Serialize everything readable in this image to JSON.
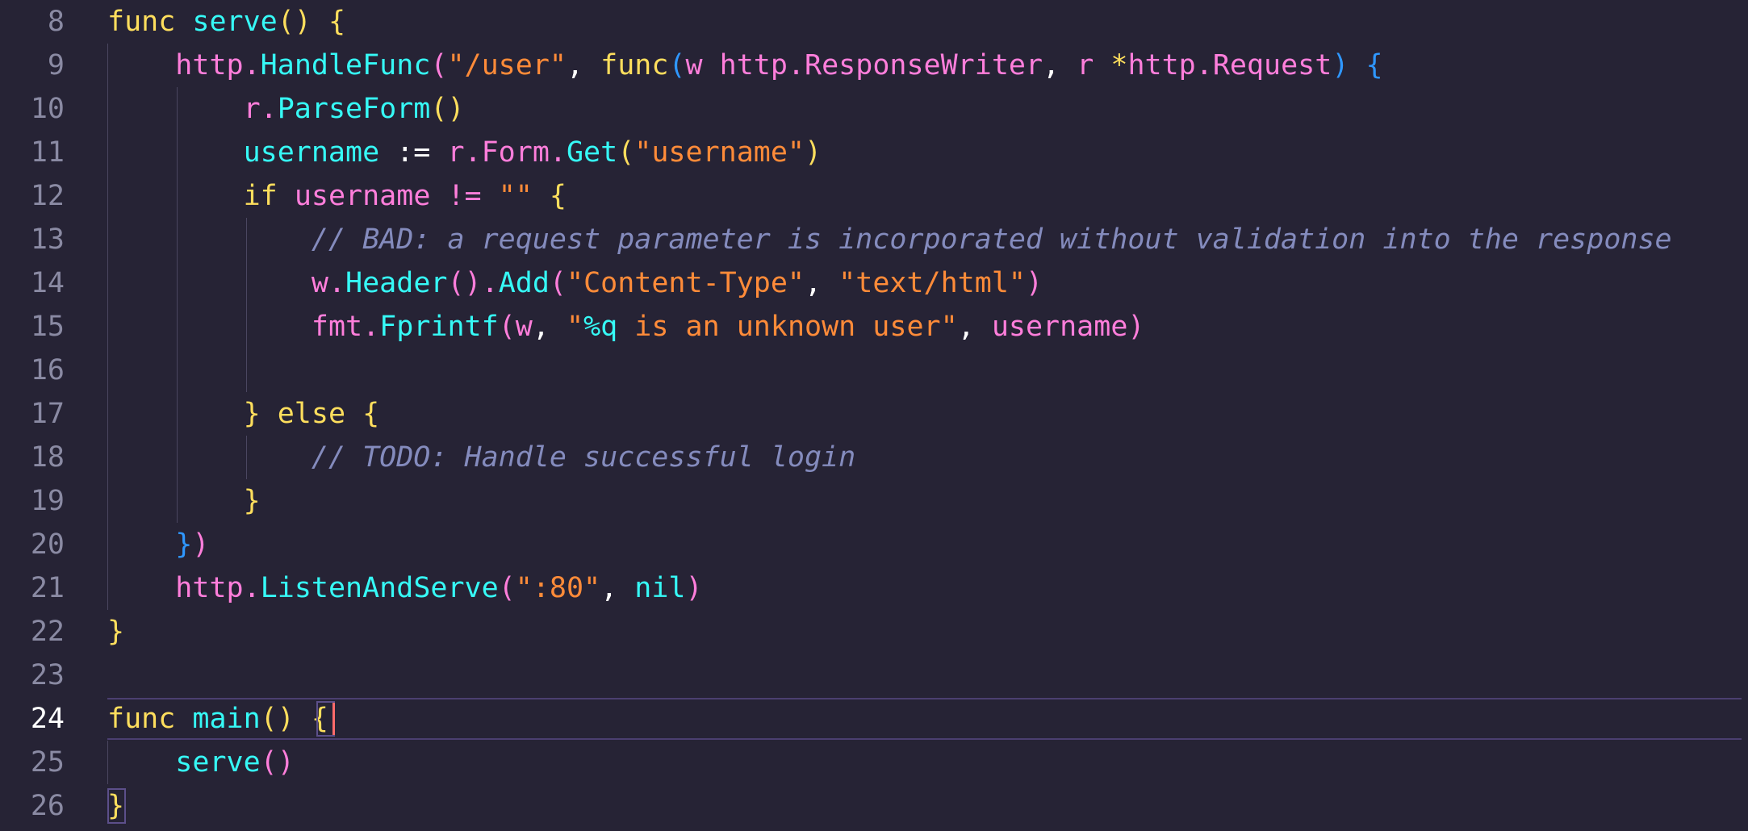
{
  "editor": {
    "active_line": "24",
    "lines": [
      {
        "num": "8"
      },
      {
        "num": "9"
      },
      {
        "num": "10"
      },
      {
        "num": "11"
      },
      {
        "num": "12"
      },
      {
        "num": "13"
      },
      {
        "num": "14"
      },
      {
        "num": "15"
      },
      {
        "num": "16"
      },
      {
        "num": "17"
      },
      {
        "num": "18"
      },
      {
        "num": "19"
      },
      {
        "num": "20"
      },
      {
        "num": "21"
      },
      {
        "num": "22"
      },
      {
        "num": "23"
      },
      {
        "num": "24"
      },
      {
        "num": "25"
      },
      {
        "num": "26"
      }
    ],
    "code": {
      "l8": {
        "kw": "func",
        "fn": "serve",
        "p1": "()",
        "br": "{"
      },
      "l9": {
        "id1": "http",
        "dot": ".",
        "fn": "HandleFunc",
        "p1": "(",
        "str": "\"/user\"",
        "c1": ", ",
        "kw": "func",
        "p2": "(",
        "id2": "w http",
        "dot2": ".",
        "fn2": "ResponseWriter",
        "c2": ", ",
        "id3": "r ",
        "star": "*",
        "id4": "http",
        "dot3": ".",
        "fn3": "Request",
        "p3": ")",
        "br": "{"
      },
      "l10": {
        "id": "r",
        "dot": ".",
        "fn": "ParseForm",
        "p": "()"
      },
      "l11": {
        "fn": "username",
        "op": " := ",
        "id": "r",
        "dot": ".",
        "fn2": "Form",
        "dot2": ".",
        "fn3": "Get",
        "p1": "(",
        "str": "\"username\"",
        "p2": ")"
      },
      "l12": {
        "kw": "if",
        "id": "username",
        "op": " != ",
        "str": "\"\"",
        "br": "{"
      },
      "l13": {
        "comment": "// BAD: a request parameter is incorporated without validation into the response"
      },
      "l14": {
        "id": "w",
        "dot": ".",
        "fn": "Header",
        "p1": "()",
        "dot2": ".",
        "fn2": "Add",
        "p2": "(",
        "str1": "\"Content-Type\"",
        "c": ", ",
        "str2": "\"text/html\"",
        "p3": ")"
      },
      "l15": {
        "id": "fmt",
        "dot": ".",
        "fn": "Fprintf",
        "p1": "(",
        "id2": "w",
        "c": ", ",
        "str1": "\"",
        "fmt": "%q",
        "str2": " is an unknown user\"",
        "c2": ", ",
        "id3": "username",
        "p2": ")"
      },
      "l17": {
        "br1": "}",
        "kw": "else",
        "br2": "{"
      },
      "l18": {
        "comment": "// TODO: Handle successful login"
      },
      "l19": {
        "br": "}"
      },
      "l20": {
        "br": "}",
        "p": ")"
      },
      "l21": {
        "id": "http",
        "dot": ".",
        "fn": "ListenAndServe",
        "p1": "(",
        "str": "\":80\"",
        "c": ", ",
        "nil": "nil",
        "p2": ")"
      },
      "l22": {
        "br": "}"
      },
      "l24": {
        "kw": "func",
        "fn": "main",
        "p": "()",
        "br": "{"
      },
      "l25": {
        "fn": "serve",
        "p": "()"
      },
      "l26": {
        "br": "}"
      }
    }
  }
}
